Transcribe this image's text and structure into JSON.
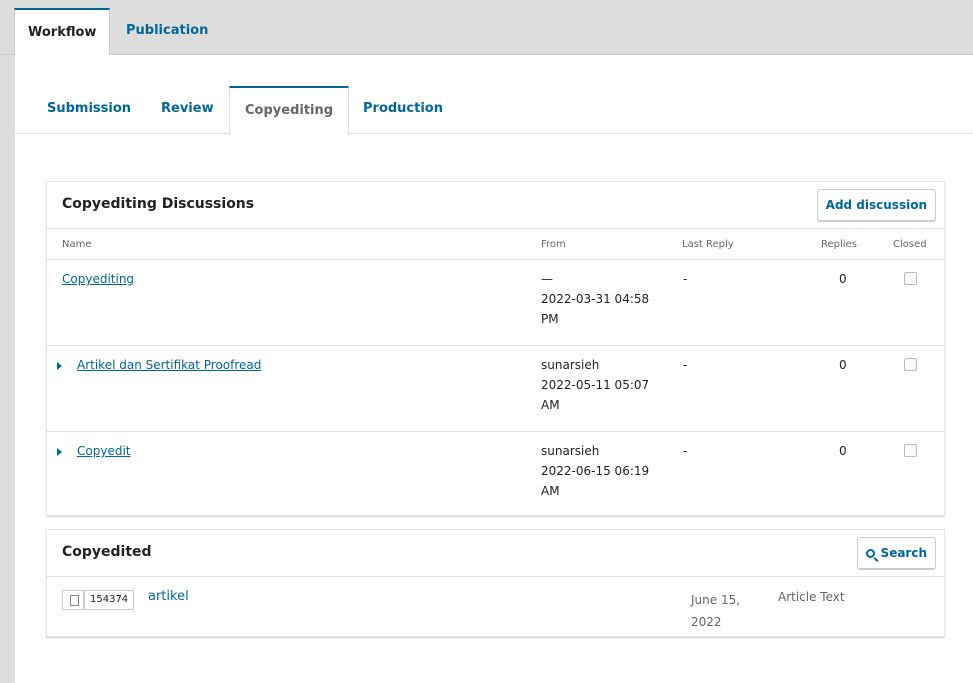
{
  "top_tabs": [
    {
      "label": "Workflow",
      "active": true
    },
    {
      "label": "Publication",
      "active": false
    }
  ],
  "sub_tabs": [
    {
      "label": "Submission"
    },
    {
      "label": "Review"
    },
    {
      "label": "Copyediting",
      "active": true
    },
    {
      "label": "Production"
    }
  ],
  "discussions": {
    "title": "Copyediting Discussions",
    "add_label": "Add discussion",
    "columns": {
      "name": "Name",
      "from": "From",
      "last_reply": "Last Reply",
      "replies": "Replies",
      "closed": "Closed"
    },
    "rows": [
      {
        "name": "Copyediting",
        "from_line1": "—",
        "from_line2": "2022-03-31 04:58",
        "from_line3": "PM",
        "last_reply": "-",
        "replies": "0",
        "closed": false
      },
      {
        "name": "Artikel dan Sertifikat Proofread",
        "from_line1": "sunarsieh",
        "from_line2": "2022-05-11 05:07",
        "from_line3": "AM",
        "last_reply": "-",
        "replies": "0",
        "closed": false
      },
      {
        "name": "Copyedit",
        "from_line1": "sunarsieh",
        "from_line2": "2022-06-15 06:19",
        "from_line3": "AM",
        "last_reply": "-",
        "replies": "0",
        "closed": false
      }
    ]
  },
  "copyedited": {
    "title": "Copyedited",
    "search_label": "Search",
    "file": {
      "id": "154374",
      "name": "artikel",
      "date_line1": "June 15,",
      "date_line2": "2022",
      "type": "Article Text"
    }
  },
  "colors": {
    "accent": "#006798"
  }
}
